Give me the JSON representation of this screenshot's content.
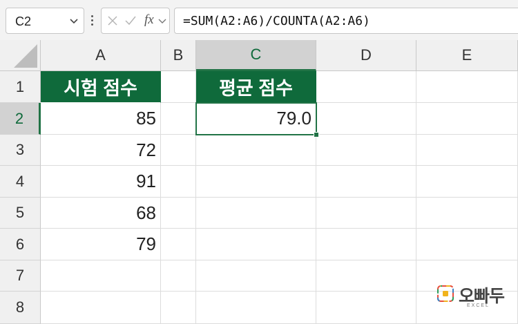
{
  "formula_bar": {
    "name_box": "C2",
    "fx_label": "fx",
    "formula": "=SUM(A2:A6)/COUNTA(A2:A6)"
  },
  "columns": [
    "A",
    "B",
    "C",
    "D",
    "E"
  ],
  "rows": [
    "1",
    "2",
    "3",
    "4",
    "5",
    "6",
    "7",
    "8"
  ],
  "cells": {
    "A1": "시험 점수",
    "A2": "85",
    "A3": "72",
    "A4": "91",
    "A5": "68",
    "A6": "79",
    "C1": "평균 점수",
    "C2": "79.0"
  },
  "selection": {
    "active_cell": "C2"
  },
  "colors": {
    "header_fill": "#0f6a3b",
    "selection_accent": "#217346"
  },
  "watermark": {
    "brand": "오빠두",
    "sub": "EXCEL"
  }
}
